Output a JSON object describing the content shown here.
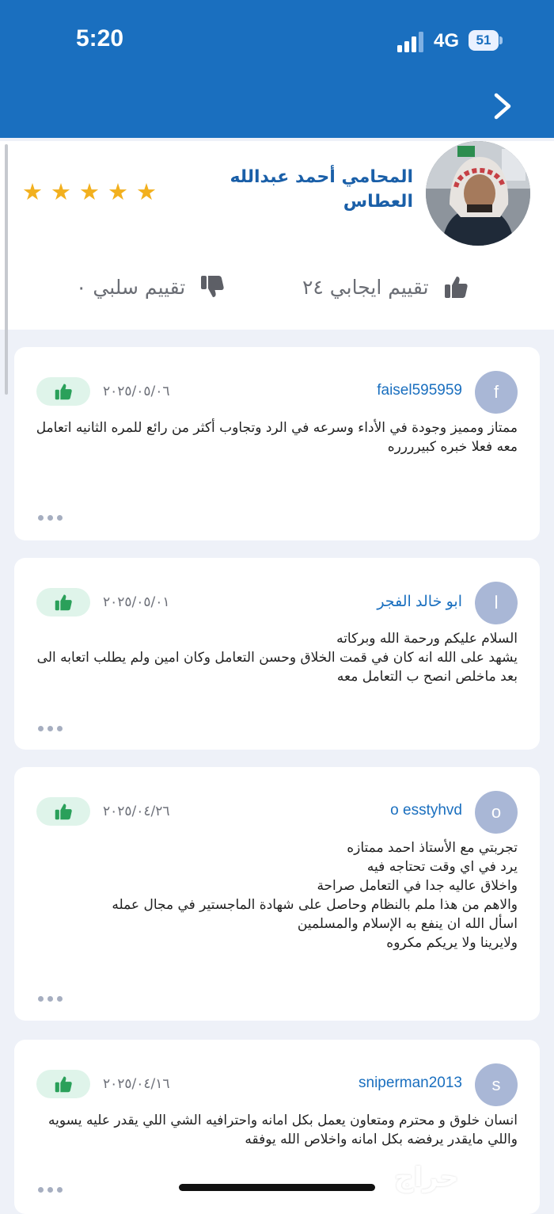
{
  "status_bar": {
    "time": "5:20",
    "network": "4G",
    "battery": "51"
  },
  "profile": {
    "name": "المحامي أحمد عبدالله العطاس",
    "stars": [
      "★",
      "★",
      "★",
      "★",
      "★"
    ],
    "positive_label": "تقييم ايجابي ٢٤",
    "negative_label": "تقييم سلبي ٠"
  },
  "reviews": [
    {
      "initial": "f",
      "user": "faisel595959",
      "date": "٢٠٢٥/٠٥/٠٦",
      "text": "ممتاز ومميز وجودة في الأداء وسرعه في الرد وتجاوب أكثر من رائع للمره الثانيه اتعامل معه  فعلا خبره كبيرررره"
    },
    {
      "initial": "ا",
      "user": "ابو خالد الفجر",
      "date": "٢٠٢٥/٠٥/٠١",
      "text": "السلام عليكم ورحمة الله وبركاته\nيشهد على الله انه كان في قمت الخلاق وحسن التعامل وكان امين ولم يطلب اتعابه الى بعد ماخلص انصح ب  التعامل معه"
    },
    {
      "initial": "o",
      "user": "o esstyhvd",
      "date": "٢٠٢٥/٠٤/٢٦",
      "text": "تجربتي مع الأستاذ احمد ممتازه\nيرد في اي وقت تحتاجه فيه\nواخلاق عاليه جدا في التعامل صراحة\nوالاهم من هذا ملم بالنظام وحاصل على شهادة الماجستير في مجال عمله\nاسأل الله ان ينفع به الإسلام والمسلمين\nولايرينا ولا يريكم مكروه"
    },
    {
      "initial": "s",
      "user": "sniperman2013",
      "date": "٢٠٢٥/٠٤/١٦",
      "text": "انسان خلوق و محترم ومتعاون يعمل بكل امانه واحترافيه الشي اللي يقدر عليه يسويه واللي مايقدر يرفضه بكل امانه واخلاص الله يوفقه"
    }
  ],
  "watermark": "حراج",
  "colors": {
    "header": "#1a6fbf",
    "accent": "#1a6fbf",
    "star": "#f2b01e",
    "badge_bg": "#dff4ea",
    "badge_icon": "#2aa05a"
  },
  "icons": {
    "back": "chevron-right-icon",
    "like": "thumbs-up-icon",
    "dislike": "thumbs-down-icon",
    "more": "more-dots-icon"
  }
}
